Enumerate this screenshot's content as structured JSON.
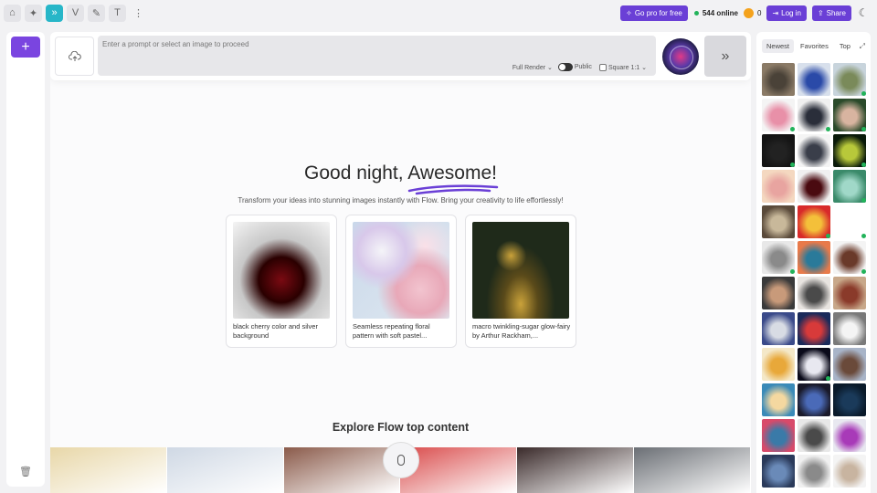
{
  "topbar": {
    "nav_icons": [
      "home-icon",
      "sparkle-icon",
      "flow-icon",
      "v-icon",
      "brush-icon",
      "text-icon",
      "more-icon"
    ],
    "pro_label": "Go pro for free",
    "online_count": "544 online",
    "coins": "0",
    "login_label": "Log in",
    "share_label": "Share"
  },
  "prompt": {
    "placeholder": "Enter a prompt or select an image to proceed",
    "render_mode": "Full Render",
    "visibility": "Public",
    "aspect": "Square 1:1"
  },
  "hero": {
    "greeting": "Good night,",
    "name": "Awesome!",
    "subtitle": "Transform your ideas into stunning images instantly with Flow. Bring your creativity to life effortlessly!"
  },
  "cards": [
    {
      "caption": "black cherry color and silver background",
      "colors": [
        "#f4f4f4",
        "#2a0000"
      ]
    },
    {
      "caption": "Seamless repeating floral pattern with soft pastel...",
      "colors": [
        "#c9d8ea",
        "#f2c4cf"
      ]
    },
    {
      "caption": "macro twinkling-sugar glow-fairy by Arthur Rackham,...",
      "colors": [
        "#1f2a1a",
        "#caa23a"
      ]
    }
  ],
  "explore": {
    "title": "Explore Flow top content",
    "strip_colors": [
      "#e8d7a8",
      "#cfd8e4",
      "#8a5a4a",
      "#d94a4a",
      "#3a2a2a",
      "#6a6e74"
    ]
  },
  "gallery": {
    "tabs": [
      "Newest",
      "Favorites",
      "Top"
    ],
    "selected_tab": "Newest",
    "thumbs": [
      {
        "c1": "#8a7a66",
        "c2": "#4a4238",
        "dot": false
      },
      {
        "c1": "#d8e0ec",
        "c2": "#2a4aa8",
        "dot": false
      },
      {
        "c1": "#c8d4dc",
        "c2": "#7a8a5a",
        "dot": true
      },
      {
        "c1": "#f4f4f4",
        "c2": "#e890a8",
        "dot": true
      },
      {
        "c1": "#f0f0f0",
        "c2": "#2a2e3a",
        "dot": true
      },
      {
        "c1": "#2a4a2a",
        "c2": "#d8b4a0",
        "dot": true
      },
      {
        "c1": "#141414",
        "c2": "#222222",
        "dot": true
      },
      {
        "c1": "#f4f4f4",
        "c2": "#3a3e4a",
        "dot": false
      },
      {
        "c1": "#0a1a0a",
        "c2": "#b8c83a",
        "dot": true
      },
      {
        "c1": "#f4d8c0",
        "c2": "#e8a4a0",
        "dot": false
      },
      {
        "c1": "#f0f0f0",
        "c2": "#4a0a10",
        "dot": false
      },
      {
        "c1": "#3a8a6a",
        "c2": "#a0d8c8",
        "dot": true
      },
      {
        "c1": "#5a4a3a",
        "c2": "#c8b89a",
        "dot": false
      },
      {
        "c1": "#d82a2a",
        "c2": "#f4c03a",
        "dot": true
      },
      {
        "c1": "#ffffff",
        "c2": "#ffffff",
        "dot": true
      },
      {
        "c1": "#e8e8e8",
        "c2": "#8a8a8a",
        "dot": true
      },
      {
        "c1": "#e87a4a",
        "c2": "#2a7a9a",
        "dot": false
      },
      {
        "c1": "#f4f4f4",
        "c2": "#6a3a2a",
        "dot": true
      },
      {
        "c1": "#3a3a3a",
        "c2": "#c89a7a",
        "dot": false
      },
      {
        "c1": "#e8e4e0",
        "c2": "#4a4a4a",
        "dot": false
      },
      {
        "c1": "#c8a88a",
        "c2": "#8a3a2a",
        "dot": false
      },
      {
        "c1": "#3a4a8a",
        "c2": "#d8dce4",
        "dot": false
      },
      {
        "c1": "#1a2a5a",
        "c2": "#d83a3a",
        "dot": false
      },
      {
        "c1": "#7a7a7a",
        "c2": "#f4f4f4",
        "dot": false
      },
      {
        "c1": "#f4e8c8",
        "c2": "#e8a83a",
        "dot": false
      },
      {
        "c1": "#0a0a1a",
        "c2": "#e8e8f0",
        "dot": true
      },
      {
        "c1": "#a8b4c8",
        "c2": "#6a4a3a",
        "dot": false
      },
      {
        "c1": "#3a8ab8",
        "c2": "#f4d8a0",
        "dot": false
      },
      {
        "c1": "#1a1a2a",
        "c2": "#4a6ab8",
        "dot": false
      },
      {
        "c1": "#0a1a2a",
        "c2": "#1a3a5a",
        "dot": false
      },
      {
        "c1": "#d84a6a",
        "c2": "#3a7aa8",
        "dot": false
      },
      {
        "c1": "#e8e8e8",
        "c2": "#4a4a4a",
        "dot": false
      },
      {
        "c1": "#e8e8f0",
        "c2": "#a83ab8",
        "dot": false
      },
      {
        "c1": "#2a3a5a",
        "c2": "#6a8ab8",
        "dot": false
      },
      {
        "c1": "#f0f0f0",
        "c2": "#8a8a8a",
        "dot": false
      },
      {
        "c1": "#f4f4f4",
        "c2": "#c8b4a0",
        "dot": false
      }
    ]
  }
}
